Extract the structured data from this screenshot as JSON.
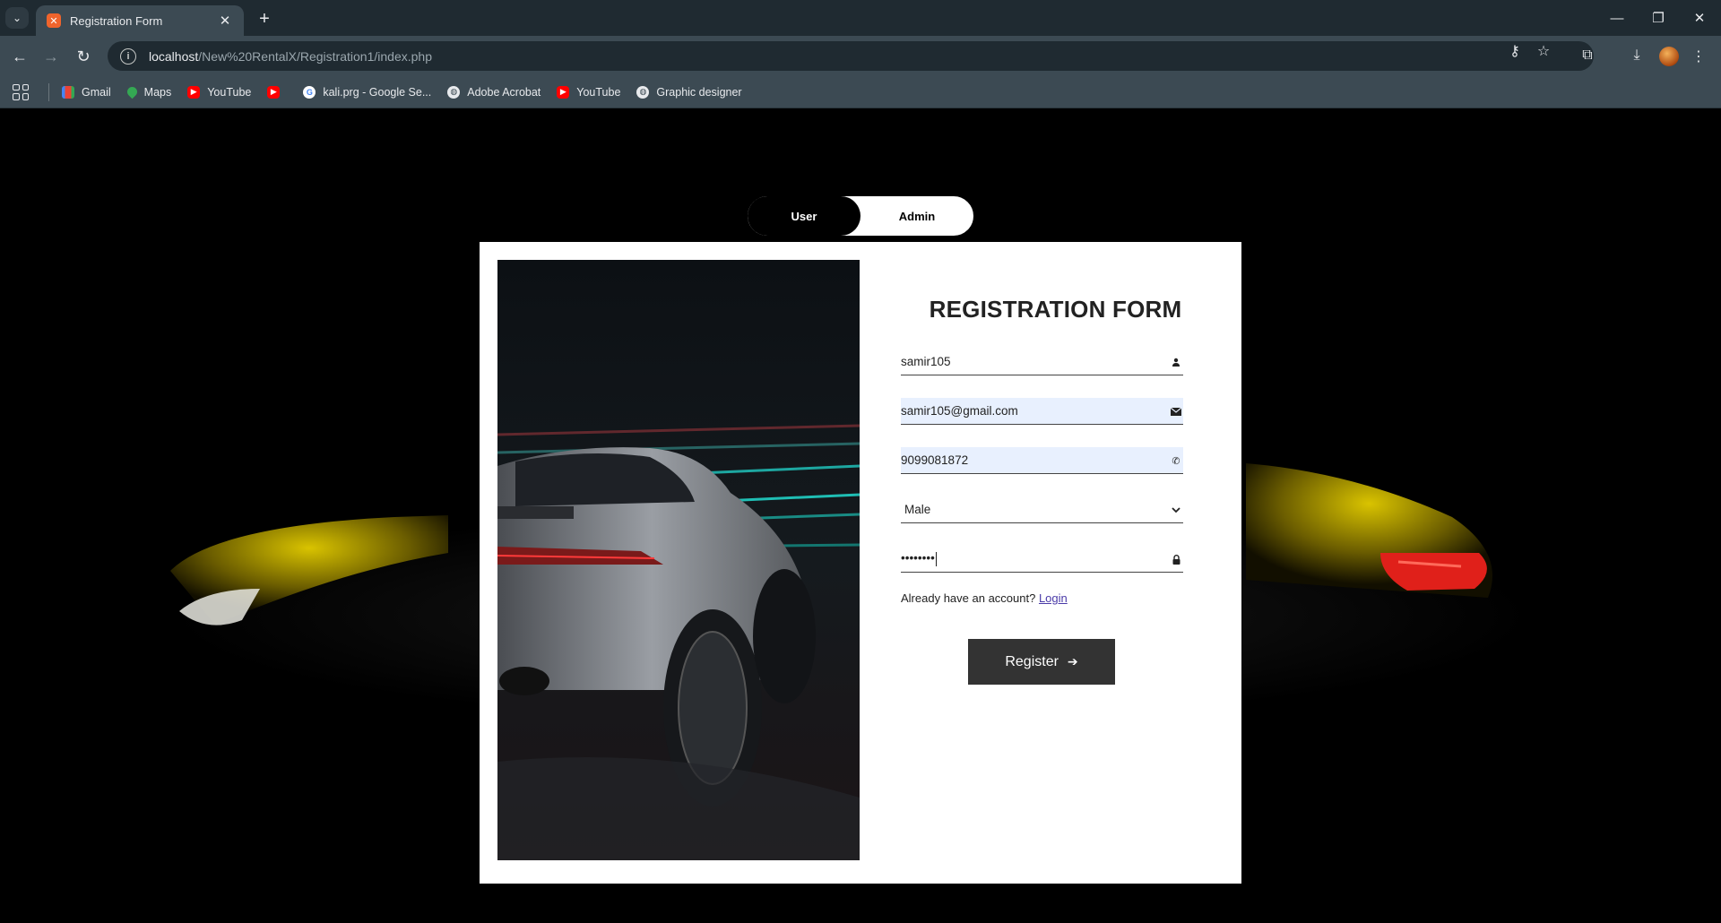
{
  "browser": {
    "tab_title": "Registration Form",
    "tab_favicon": "XAMPP",
    "url_host": "localhost",
    "url_path": "/New%20RentalX/Registration1/index.php",
    "bookmarks": [
      {
        "label": "Gmail",
        "icon": "gmail-icon"
      },
      {
        "label": "Maps",
        "icon": "maps-icon"
      },
      {
        "label": "YouTube",
        "icon": "youtube-icon"
      },
      {
        "label": "",
        "icon": "youtube-icon"
      },
      {
        "label": "kali.prg - Google Se...",
        "icon": "google-icon"
      },
      {
        "label": "Adobe Acrobat",
        "icon": "globe-icon"
      },
      {
        "label": "YouTube",
        "icon": "youtube-icon"
      },
      {
        "label": "Graphic designer",
        "icon": "globe-icon"
      }
    ]
  },
  "toggle": {
    "user_label": "User",
    "admin_label": "Admin",
    "active": "User"
  },
  "form": {
    "title": "REGISTRATION FORM",
    "username_value": "samir105",
    "email_value": "samir105@gmail.com",
    "phone_value": "9099081872",
    "gender_value": "Male",
    "password_value": "••••••••",
    "already_text": "Already have an account?",
    "login_link": "Login",
    "register_label": "Register"
  },
  "colors": {
    "page_bg": "#000000",
    "card_bg": "#ffffff",
    "button_bg": "#333333",
    "autofill_bg": "#e8f0fe",
    "accent_yellow": "#c9b400"
  }
}
